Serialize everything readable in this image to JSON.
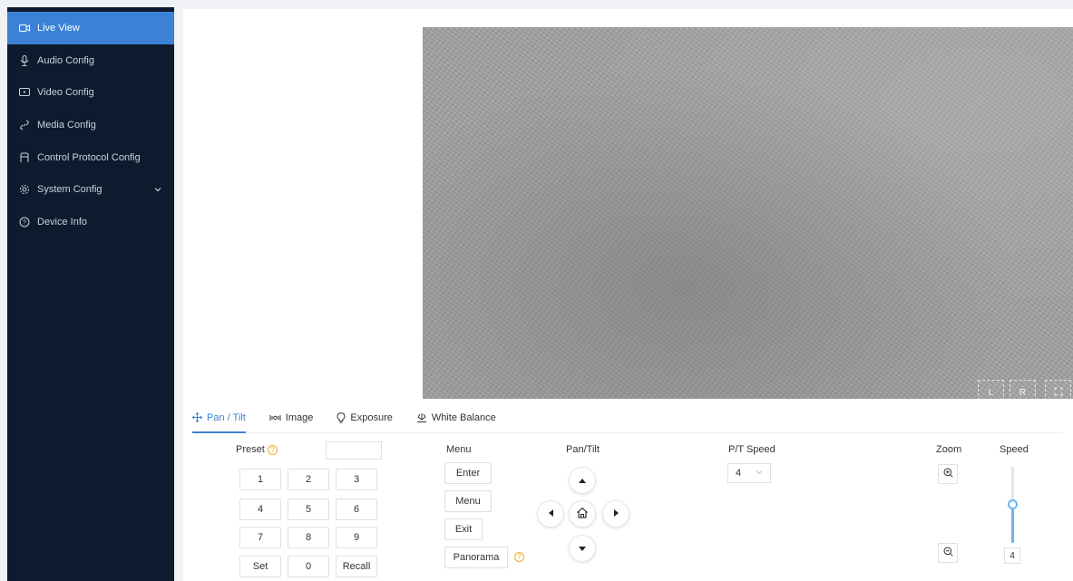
{
  "sidebar": {
    "items": [
      {
        "label": "Live View",
        "icon": "video-camera-icon",
        "active": true
      },
      {
        "label": "Audio Config",
        "icon": "microphone-icon"
      },
      {
        "label": "Video Config",
        "icon": "screen-icon"
      },
      {
        "label": "Media Config",
        "icon": "link-icon"
      },
      {
        "label": "Control Protocol Config",
        "icon": "protocol-icon"
      },
      {
        "label": "System Config",
        "icon": "gear-icon",
        "expandable": true
      },
      {
        "label": "Device Info",
        "icon": "info-icon"
      }
    ]
  },
  "video_overlay": {
    "left": "L",
    "right": "R",
    "fullscreen": "fullscreen-icon"
  },
  "tabs": [
    {
      "label": "Pan / Tilt",
      "icon": "move-icon",
      "active": true
    },
    {
      "label": "Image",
      "icon": "image-icon"
    },
    {
      "label": "Exposure",
      "icon": "bulb-icon"
    },
    {
      "label": "White Balance",
      "icon": "balance-icon"
    }
  ],
  "preset": {
    "label": "Preset",
    "keys": [
      "1",
      "2",
      "3",
      "4",
      "5",
      "6",
      "7",
      "8",
      "9",
      "Set",
      "0",
      "Recall"
    ]
  },
  "menu": {
    "label": "Menu",
    "enter": "Enter",
    "menu": "Menu",
    "exit": "Exit",
    "panorama": "Panorama"
  },
  "pantilt": {
    "label": "Pan/Tilt"
  },
  "ptspeed": {
    "label": "P/T Speed",
    "value": "4"
  },
  "zoom": {
    "label": "Zoom"
  },
  "speed": {
    "label": "Speed",
    "value": "4"
  },
  "colors": {
    "accent": "#3b82d6",
    "sidebar_bg": "#0e1b2e",
    "help": "#f0ad2a"
  }
}
